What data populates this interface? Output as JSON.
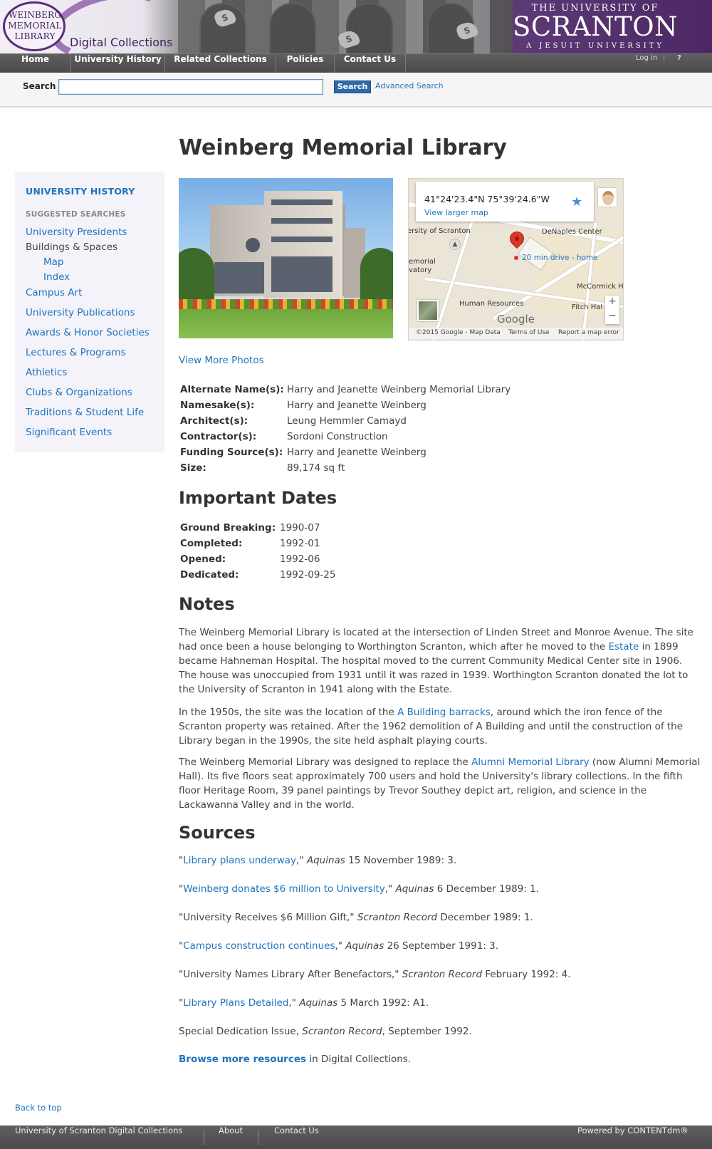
{
  "banner": {
    "logo_line1": "WEINBERG",
    "logo_line2": "MEMORIAL",
    "logo_line3": "LIBRARY",
    "collection_name": "Digital Collections",
    "university_top": "THE UNIVERSITY OF",
    "university_name": "SCRANTON",
    "university_tagline": "A JESUIT UNIVERSITY"
  },
  "nav": {
    "items": [
      {
        "label": "Home"
      },
      {
        "label": "University History"
      },
      {
        "label": "Related Collections"
      },
      {
        "label": "Policies"
      },
      {
        "label": "Contact Us"
      }
    ],
    "login": "Log in",
    "help": "?"
  },
  "search": {
    "label": "Search",
    "value": "",
    "placeholder": "",
    "button": "Search",
    "advanced": "Advanced Search"
  },
  "sidebar": {
    "heading": "UNIVERSITY HISTORY",
    "subheading": "SUGGESTED SEARCHES",
    "items": [
      {
        "label": "University Presidents"
      },
      {
        "label": "Buildings & Spaces"
      },
      {
        "label": "Map"
      },
      {
        "label": "Index"
      },
      {
        "label": "Campus Art"
      },
      {
        "label": "University Publications"
      },
      {
        "label": "Awards & Honor Societies"
      },
      {
        "label": "Lectures & Programs"
      },
      {
        "label": "Athletics"
      },
      {
        "label": "Clubs & Organizations"
      },
      {
        "label": "Traditions & Student Life"
      },
      {
        "label": "Significant Events"
      }
    ]
  },
  "main": {
    "title": "Weinberg Memorial Library",
    "map": {
      "coords": "41°24'23.4\"N 75°39'24.6\"W",
      "larger": "View larger map",
      "labels": [
        "ersity of Scranton",
        "DeNaples Center",
        "emorial",
        "vatory",
        "McCormick Ha",
        "Human Resources",
        "Fitch Hal"
      ],
      "drive": "20 min drive - home",
      "google": "Google",
      "footer_data": "©2015 Google - Map Data",
      "footer_terms": "Terms of Use",
      "footer_report": "Report a map error",
      "zoom_in": "+",
      "zoom_out": "−"
    },
    "view_more": "View More Photos",
    "facts": [
      {
        "label": "Alternate Name(s):",
        "value": "Harry and Jeanette Weinberg Memorial Library"
      },
      {
        "label": "Namesake(s):",
        "value": "Harry and Jeanette Weinberg"
      },
      {
        "label": "Architect(s):",
        "value": "Leung Hemmler Camayd"
      },
      {
        "label": "Contractor(s):",
        "value": "Sordoni Construction"
      },
      {
        "label": "Funding Source(s):",
        "value": "Harry and Jeanette Weinberg"
      },
      {
        "label": "Size:",
        "value": "89,174 sq ft"
      }
    ],
    "dates_heading": "Important Dates",
    "dates": [
      {
        "label": "Ground Breaking:",
        "value": "1990-07"
      },
      {
        "label": "Completed:",
        "value": "1992-01"
      },
      {
        "label": "Opened:",
        "value": "1992-06"
      },
      {
        "label": "Dedicated:",
        "value": "1992-09-25"
      }
    ],
    "notes_heading": "Notes",
    "notes": [
      {
        "before": "The Weinberg Memorial Library is located at the intersection of Linden Street and Monroe Avenue. The site had once been a house belonging to Worthington Scranton, which after he moved to the ",
        "link": "Estate",
        "after": " in 1899 became Hahneman Hospital. The hospital moved to the current Community Medical Center site in 1906. The house was unoccupied from 1931 until it was razed in 1939. Worthington Scranton donated the lot to the University of Scranton in 1941 along with the Estate."
      },
      {
        "before": "In the 1950s, the site was the location of the ",
        "link": "A Building barracks",
        "after": ", around which the iron fence of the Scranton property was retained. After the 1962 demolition of A Building and until the construction of the Library began in the 1990s, the site held asphalt playing courts."
      },
      {
        "before": "The Weinberg Memorial Library was designed to replace the ",
        "link": "Alumni Memorial Library",
        "after": " (now Alumni Memorial Hall). Its five floors seat approximately 700 users and hold the University's library collections. In the fifth floor Heritage Room, 39 panel paintings by Trevor Southey depict art, religion, and science in the Lackawanna Valley and in the world."
      }
    ],
    "sources_heading": "Sources",
    "sources": [
      {
        "open": "\"",
        "link": "Library plans underway",
        "title": "",
        "close": ",\" ",
        "pub": "Aquinas",
        "rest": " 15 November 1989: 3."
      },
      {
        "open": "\"",
        "link": "Weinberg donates $6 million to University",
        "title": "",
        "close": ",\" ",
        "pub": "Aquinas",
        "rest": " 6 December 1989: 1."
      },
      {
        "open": "\"",
        "link": "",
        "title": "University Receives $6 Million Gift",
        "close": ",\" ",
        "pub": "Scranton Record",
        "rest": " December 1989: 1."
      },
      {
        "open": "\"",
        "link": "Campus construction continues",
        "title": "",
        "close": ",\" ",
        "pub": "Aquinas",
        "rest": " 26 September 1991: 3."
      },
      {
        "open": "\"",
        "link": "",
        "title": "University Names Library After Benefactors",
        "close": ",\" ",
        "pub": "Scranton Record",
        "rest": " February 1992: 4."
      },
      {
        "open": "\"",
        "link": "Library Plans Detailed",
        "title": "",
        "close": ",\" ",
        "pub": "Aquinas",
        "rest": " 5 March 1992: A1."
      },
      {
        "open": "",
        "link": "",
        "title": "Special Dedication Issue, ",
        "close": "",
        "pub": "Scranton Record",
        "rest": ", September 1992."
      }
    ],
    "browse_link": "Browse more resources",
    "browse_rest": " in Digital Collections."
  },
  "back_to_top": "Back to top",
  "footer": {
    "site": "University of Scranton Digital Collections",
    "about": "About",
    "contact": "Contact Us",
    "powered": "Powered by CONTENTdm®"
  },
  "colors": {
    "link": "#1e73be",
    "nav_bg": "#555555",
    "banner_purple": "#4b2863",
    "sidebar_bg": "#f4f3f9"
  }
}
